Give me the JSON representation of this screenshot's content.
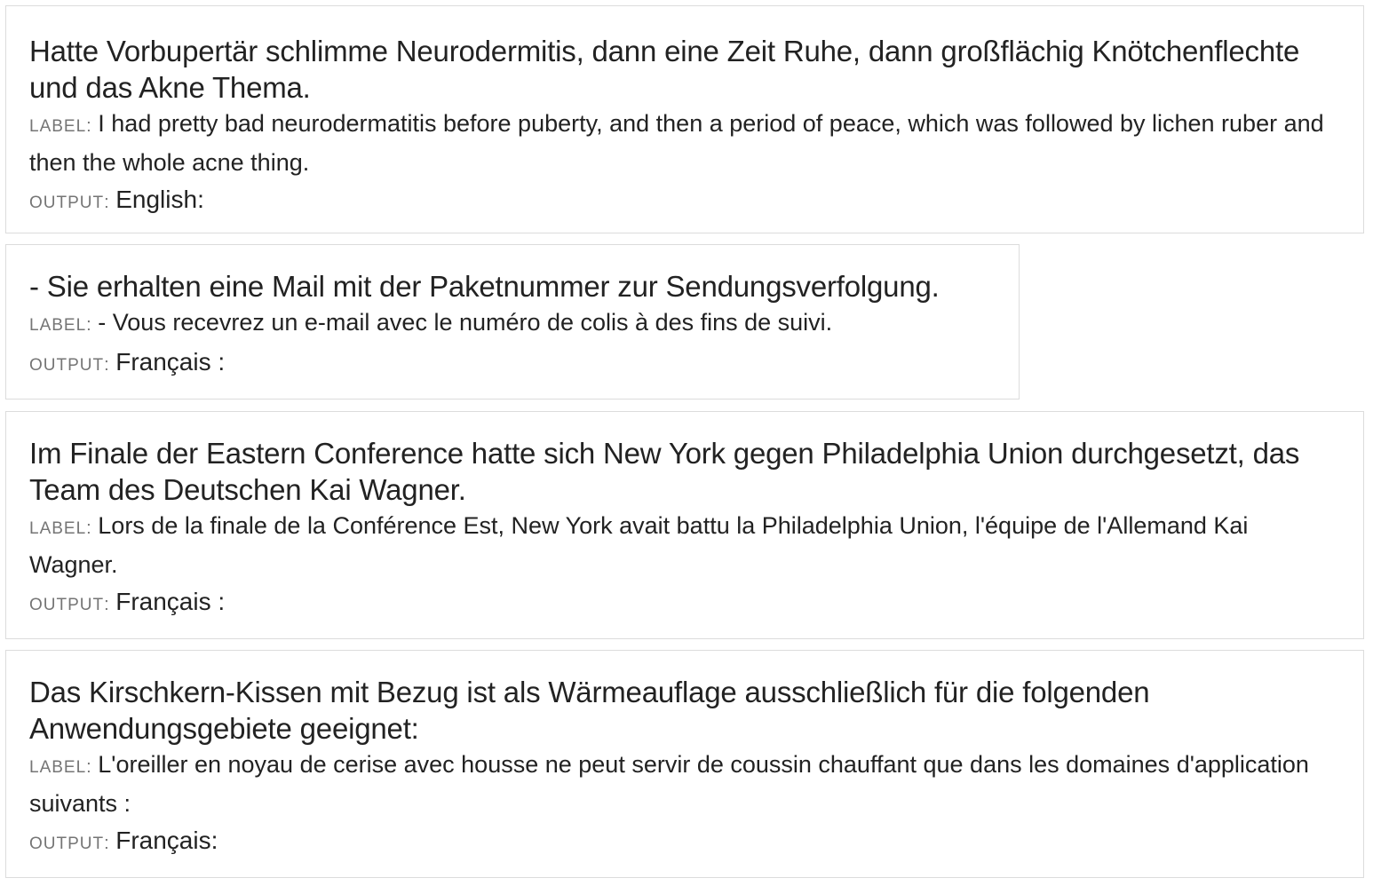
{
  "tags": {
    "label": "LABEL",
    "output": "OUTPUT"
  },
  "examples": [
    {
      "source": "Hatte Vorbupertär schlimme Neurodermitis, dann eine Zeit Ruhe, dann großflächig Knötchenflechte und das Akne Thema.",
      "label": "I had pretty bad neurodermatitis before puberty, and then a period of peace, which was followed by lichen ruber and then the whole acne thing.",
      "output": "English:"
    },
    {
      "source": "- Sie erhalten eine Mail mit der Paketnummer zur Sendungsverfolgung.",
      "label": "- Vous recevrez un e-mail avec le numéro de colis à des fins de suivi.",
      "output": "Français :"
    },
    {
      "source": "Im Finale der Eastern Conference hatte sich New York gegen Philadelphia Union durchgesetzt, das Team des Deutschen Kai Wagner.",
      "label": "Lors de la finale de la Conférence Est, New York avait battu la Philadelphia Union, l'équipe de l'Allemand Kai Wagner.",
      "output": "Français :"
    },
    {
      "source": "Das Kirschkern-Kissen mit Bezug ist als Wärmeauflage ausschließlich für die folgenden Anwendungsgebiete geeignet:",
      "label": "L'oreiller en noyau de cerise avec housse ne peut servir de coussin chauffant que dans les domaines d'application suivants :",
      "output": "Français:"
    }
  ]
}
